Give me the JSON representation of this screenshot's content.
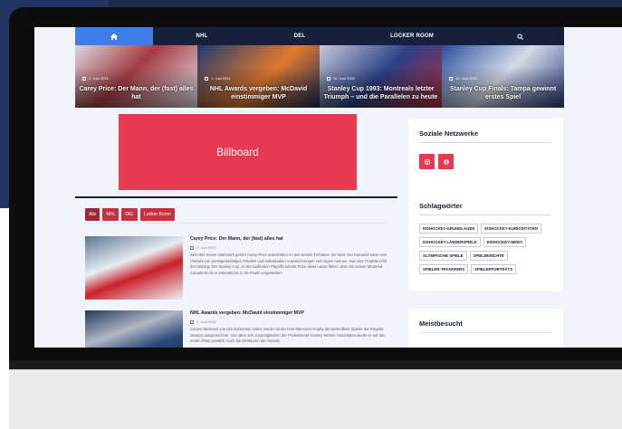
{
  "nav": {
    "home_icon": "home-icon",
    "items": [
      "NHL",
      "DEL",
      "LOCKER ROOM"
    ],
    "search_icon": "search-icon"
  },
  "hero": [
    {
      "date": "1. Juni 2021",
      "title": "Carey Price: Der Mann, der (fast) alles hat"
    },
    {
      "date": "1. Juni 2021",
      "title": "NHL Awards vergeben: McDavid einstimmiger MVP"
    },
    {
      "date": "30. Juni 2021",
      "title": "Stanley Cup 1993: Montreals letzter Triumph – und die Parallelen zu heute"
    },
    {
      "date": "30. Juni 2021",
      "title": "Stanley Cup Finals: Tampa gewinnt erstes Spiel"
    }
  ],
  "billboard": "Billboard",
  "filters": [
    "Alle",
    "NHL",
    "DEL",
    "Locker Room"
  ],
  "articles": [
    {
      "title": "Carey Price: Der Mann, der (fast) alles hat",
      "date": "1. Juni 2021",
      "body": "Seit über einem Jahrzehnt gehört Carey Price unbestritten zu den besten Torhütern der Welt. Der Kanadier kann eine Vielzahl von prestigeträchtigen Pokalen und individuellen Auszeichnungen sein Eigen nennen. Nur eine Trophäe fehlt ihm bislang: Der Stanley Cup. In den laufenden Playoffs könnte Price diese Lücke füllen, denn mit seinen Montreal Canadiens ist er erstmals bis in die Finals vorgestoßen."
    },
    {
      "title": "NHL Awards vergeben: McDavid einstimmiger MVP",
      "date": "1. Juni 2021",
      "body": "Connor McDavid von den Edmonton Oilers wurde mit der Hart Memorial Trophy als wertvollster Spieler der Regular Season ausgezeichnet. Von allen 100 Jurymitgliedern der Professional Hockey Writers Association wurde er auf den ersten Platz gewählt. Auch die Direktoren der Awards"
    }
  ],
  "sidebar": {
    "social_title": "Soziale Netzwerke",
    "social_icons": [
      "instagram-icon",
      "facebook-icon"
    ],
    "tags_title": "Schlagwörter",
    "tags": [
      "EISHOCKEY-GRUNDLAGEN",
      "EISHOCKEY-KURIOSITÄTEN",
      "EISHOCKEY-LÄNDERSPIELE",
      "EISHOCKEY-NEWS",
      "OLYMPISCHE SPIELE",
      "SPIELBERICHTE",
      "SPIELER-TRANSFERS",
      "SPIELERPORTRÄTS"
    ],
    "most_visited_title": "Meistbesucht"
  },
  "colors": {
    "nav": "#16203b",
    "accent": "#e73950",
    "home_active": "#3f7de8",
    "filter": "#c8303d"
  }
}
